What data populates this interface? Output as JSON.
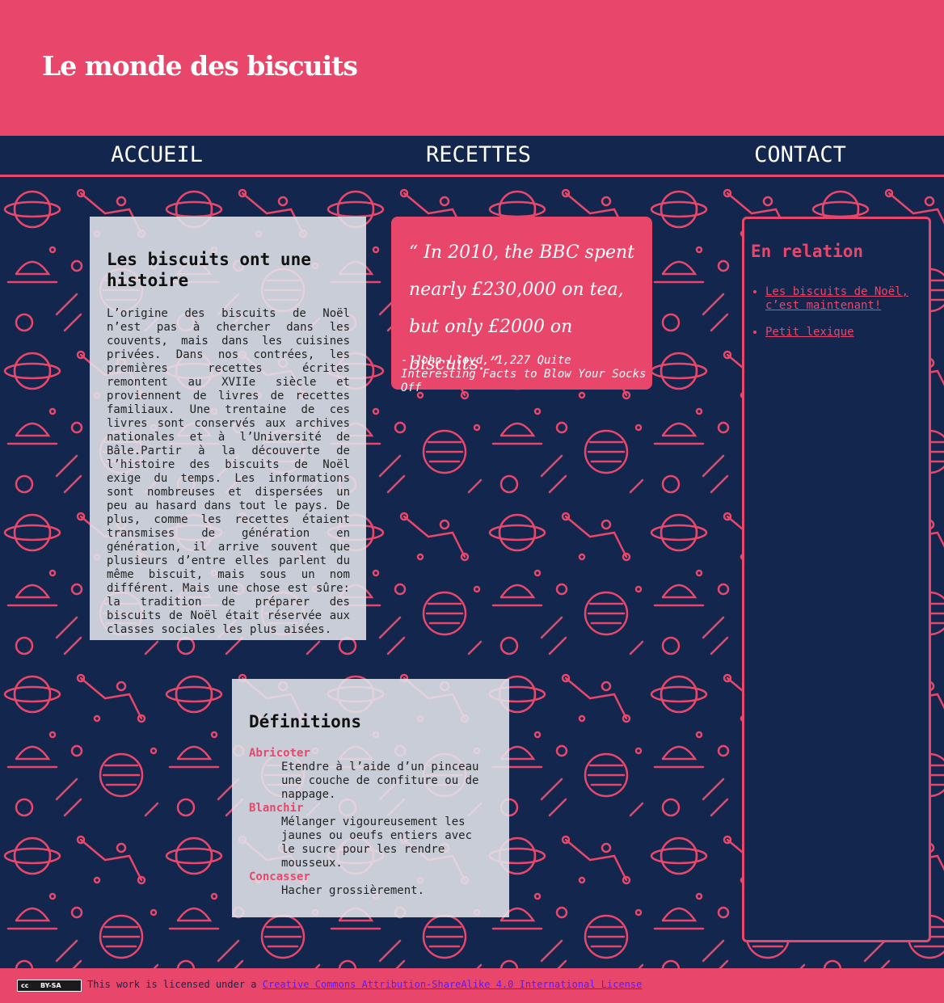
{
  "site": {
    "title": "Le monde des biscuits"
  },
  "nav": {
    "items": [
      "ACCUEIL",
      "RECETTES",
      "CONTACT"
    ]
  },
  "history": {
    "title": "Les biscuits ont une histoire",
    "body": "L’origine des biscuits de Noël n’est pas à chercher dans les couvents, mais dans les cuisines privées. Dans nos contrées, les premières recettes écrites remontent au XVIIe siècle et proviennent de livres de recettes familiaux. Une trentaine de ces livres sont conservés aux archives nationales et à l’Université de Bâle.Partir à la découverte de l’histoire des biscuits de Noël exige du temps. Les informations sont nombreuses et dispersées un peu au hasard dans tout le pays. De plus, comme les recettes étaient transmises de génération en génération, il arrive souvent que plusieurs d’entre elles parlent du même biscuit, mais sous un nom différent. Mais une chose est sûre: la tradition de préparer des biscuits de Noël était réservée aux classes sociales les plus aisées."
  },
  "quote": {
    "text": "“ In 2010, the BBC spent nearly £230,000 on tea, but only £2000 on biscuits. ”",
    "source": "- John Lloyd, 1,227 Quite Interesting Facts to Blow Your Socks Off"
  },
  "related": {
    "title": "En relation",
    "links": [
      "Les biscuits de Noël, c’est maintenant!",
      "Petit lexique"
    ]
  },
  "definitions": {
    "title": "Définitions",
    "terms": [
      {
        "term": "Abricoter",
        "definition": "Etendre à l’aide d’un pinceau une couche de confiture ou de nappage."
      },
      {
        "term": "Blanchir",
        "definition": "Mélanger vigoureusement les jaunes ou oeufs entiers avec le sucre pour les rendre mousseux."
      },
      {
        "term": "Concasser",
        "definition": "Hacher grossièrement."
      }
    ]
  },
  "footer": {
    "badge_left": "cc",
    "badge_right": "BY-SA",
    "text": "This work is licensed under a ",
    "link": "Creative Commons Attribution-ShareAlike 4.0 International License"
  },
  "colors": {
    "primary": "#e8476b",
    "navy": "#13264d",
    "card": "#e1e5ec"
  }
}
